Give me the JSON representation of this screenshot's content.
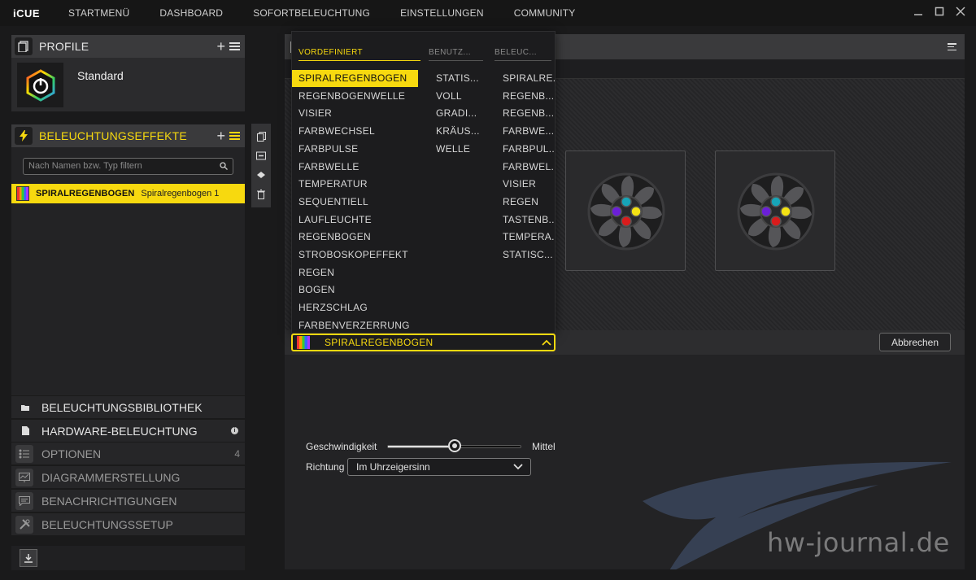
{
  "app": {
    "name": "iCUE"
  },
  "topnav": [
    "STARTMENÜ",
    "DASHBOARD",
    "SOFORTBELEUCHTUNG",
    "EINSTELLUNGEN",
    "COMMUNITY"
  ],
  "window_controls": [
    "minimize-icon",
    "maximize-icon",
    "close-icon"
  ],
  "profile": {
    "header": "PROFILE",
    "name": "Standard"
  },
  "effects": {
    "header": "BELEUCHTUNGSEFFEKTE",
    "search_placeholder": "Nach Namen bzw. Typ filtern",
    "selected_type": "SPIRALREGENBOGEN",
    "selected_name": "Spiralregenbogen 1"
  },
  "side_tools": [
    "copy-icon",
    "paste-icon",
    "layers-icon",
    "trash-icon"
  ],
  "sections": {
    "library": "BELEUCHTUNGSBIBLIOTHEK",
    "hardware": "HARDWARE-BELEUCHTUNG",
    "options": "OPTIONEN",
    "options_count": "4",
    "diagram": "DIAGRAMMERSTELLUNG",
    "notifications": "BENACHRICHTIGUNGEN",
    "setup": "BELEUCHTUNGSSETUP"
  },
  "popup": {
    "columns": [
      "VORDEFINIERT",
      "BENUTZ...",
      "BELEUC..."
    ],
    "predefined": [
      "SPIRALREGENBOGEN",
      "REGENBOGENWELLE",
      "VISIER",
      "FARBWECHSEL",
      "FARBPULSE",
      "FARBWELLE",
      "TEMPERATUR",
      "SEQUENTIELL",
      "LAUFLEUCHTE",
      "REGENBOGEN",
      "STROBOSKOPEFFEKT",
      "REGEN",
      "BOGEN",
      "HERZSCHLAG",
      "FARBENVERZERRUNG"
    ],
    "custom": [
      "STATIS...",
      "VOLL",
      "GRADI...",
      "KRÄUS...",
      "WELLE"
    ],
    "lighting": [
      "SPIRALRE...",
      "REGENB...",
      "REGENB...",
      "FARBWE...",
      "FARBPUL...",
      "FARBWEL...",
      "VISIER",
      "REGEN",
      "TASTENB...",
      "TEMPERA...",
      "STATISC..."
    ],
    "selected": "SPIRALREGENBOGEN"
  },
  "actions": {
    "cancel": "Abbrechen"
  },
  "settings": {
    "speed_label": "Geschwindigkeit",
    "speed_value": "Mittel",
    "speed_level": 0.5,
    "direction_label": "Richtung",
    "direction_value": "Im Uhrzeigersinn"
  },
  "watermark": "hw-journal.de",
  "colors": {
    "accent": "#f7d90f",
    "fan_led": [
      "#17a4b6",
      "#f4e214",
      "#d91c1c",
      "#6b1fd8"
    ]
  }
}
